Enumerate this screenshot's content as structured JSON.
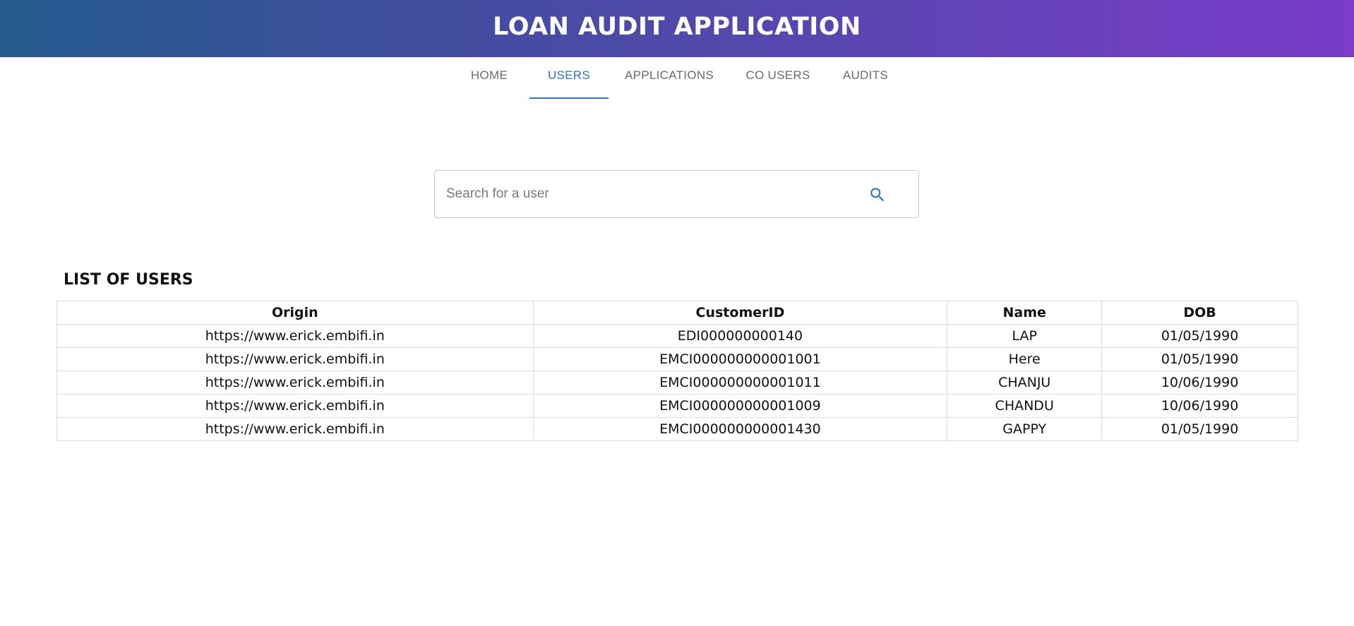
{
  "header": {
    "title": "LOAN AUDIT APPLICATION"
  },
  "nav": {
    "tabs": [
      {
        "label": "HOME"
      },
      {
        "label": "USERS",
        "active": true
      },
      {
        "label": "APPLICATIONS"
      },
      {
        "label": "CO USERS"
      },
      {
        "label": "AUDITS"
      }
    ]
  },
  "search": {
    "placeholder": "Search for a user",
    "value": "",
    "icon": "search-icon"
  },
  "users": {
    "title": "LIST OF USERS",
    "columns": [
      "Origin",
      "CustomerID",
      "Name",
      "DOB"
    ],
    "rows": [
      {
        "origin": "https://www.erick.embifi.in",
        "customer_id": "EDI000000000140",
        "name": "LAP",
        "dob": "01/05/1990"
      },
      {
        "origin": "https://www.erick.embifi.in",
        "customer_id": "EMCI000000000001001",
        "name": "Here",
        "dob": "01/05/1990"
      },
      {
        "origin": "https://www.erick.embifi.in",
        "customer_id": "EMCI000000000001011",
        "name": "CHANJU",
        "dob": "10/06/1990"
      },
      {
        "origin": "https://www.erick.embifi.in",
        "customer_id": "EMCI000000000001009",
        "name": "CHANDU",
        "dob": "10/06/1990"
      },
      {
        "origin": "https://www.erick.embifi.in",
        "customer_id": "EMCI000000000001430",
        "name": "GAPPY",
        "dob": "01/05/1990"
      }
    ]
  },
  "colors": {
    "header_gradient_start": "#245a8d",
    "header_gradient_end": "#7a3cc9",
    "accent": "#2f73c6",
    "tab_inactive": "#6b6b6b"
  }
}
